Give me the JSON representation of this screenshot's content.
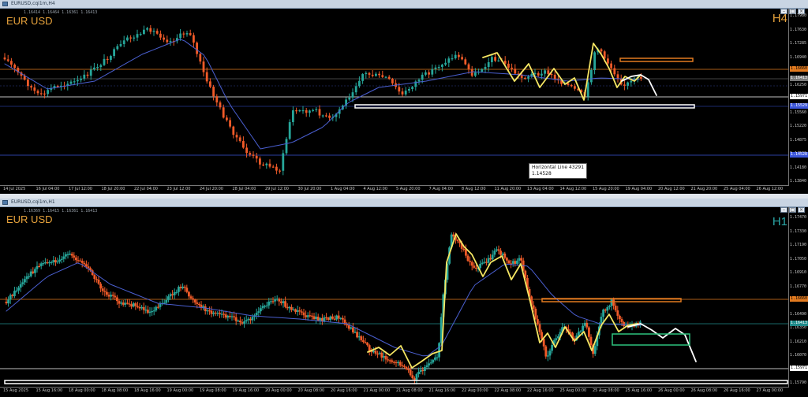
{
  "top": {
    "window_title": "EURUSD,cqi1m,H4",
    "symbol_label": "EUR USD",
    "timeframe": "H4",
    "ohlc_text": "1.16414 1.16464 1.16361 1.16413",
    "y_ticks": [
      "1.17980",
      "1.17630",
      "1.17285",
      "1.16940",
      "1.16595",
      "1.16250",
      "1.15905",
      "1.15560",
      "1.15220",
      "1.14875",
      "1.14530",
      "1.14180",
      "1.13840"
    ],
    "price_badges": {
      "orange": "1.16660",
      "grey": "1.16413",
      "white": "1.15971",
      "blue": "1.15529",
      "blue_low": "1.14528"
    },
    "x_ticks": [
      "14 Jul 2025",
      "16 Jul 04:00",
      "17 Jul 12:00",
      "18 Jul 20:00",
      "22 Jul 04:00",
      "23 Jul 12:00",
      "24 Jul 20:00",
      "28 Jul 04:00",
      "29 Jul 12:00",
      "30 Jul 20:00",
      "1 Aug 04:00",
      "4 Aug 12:00",
      "5 Aug 20:00",
      "7 Aug 04:00",
      "8 Aug 12:00",
      "11 Aug 20:00",
      "13 Aug 04:00",
      "14 Aug 12:00",
      "15 Aug 20:00",
      "19 Aug 04:00",
      "20 Aug 12:00",
      "21 Aug 20:00",
      "25 Aug 04:00",
      "26 Aug 12:00"
    ],
    "tooltip": {
      "line1": "Horizontal Line 43291",
      "line2": "1.14528"
    },
    "colors": {
      "bull": "#26a69a",
      "bear": "#f05a28",
      "ma": "#4a5fd0",
      "path_yellow": "#f5e663",
      "orange_line": "#e37b20",
      "white_line": "#ffffff",
      "blue_line": "#3b55d9"
    }
  },
  "bottom": {
    "window_title": "EURUSD,cqi1m,H1",
    "symbol_label": "EUR USD",
    "timeframe": "H1",
    "ohlc_text": "1.16369 1.16415 1.16361 1.16413",
    "y_ticks": [
      "1.17470",
      "1.17330",
      "1.17190",
      "1.17050",
      "1.16910",
      "1.16770",
      "1.16630",
      "1.16490",
      "1.16350",
      "1.16210",
      "1.16070",
      "1.15930",
      "1.15790"
    ],
    "price_badges": {
      "orange": "1.16660",
      "teal": "1.16413",
      "white": "1.15971"
    },
    "x_ticks": [
      "15 Aug 2025",
      "15 Aug 16:00",
      "18 Aug 00:00",
      "18 Aug 08:00",
      "18 Aug 16:00",
      "19 Aug 00:00",
      "19 Aug 08:00",
      "19 Aug 16:00",
      "20 Aug 00:00",
      "20 Aug 08:00",
      "20 Aug 16:00",
      "21 Aug 00:00",
      "21 Aug 08:00",
      "21 Aug 16:00",
      "22 Aug 00:00",
      "22 Aug 08:00",
      "22 Aug 16:00",
      "25 Aug 00:00",
      "25 Aug 08:00",
      "25 Aug 16:00",
      "26 Aug 00:00",
      "26 Aug 08:00",
      "26 Aug 16:00",
      "27 Aug 00:00"
    ],
    "colors": {
      "bull": "#26a69a",
      "bear": "#f05a28",
      "ma": "#4a5fd0",
      "path_yellow": "#f5e663",
      "orange_line": "#e37b20",
      "teal_line": "#1f8a8a",
      "white_line": "#ffffff",
      "green_box": "#2ec27e"
    }
  }
}
